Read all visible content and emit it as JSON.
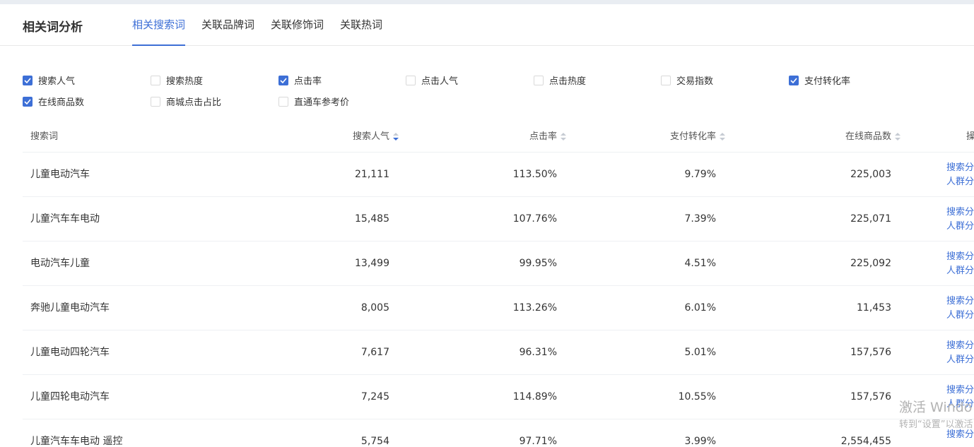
{
  "page": {
    "title": "相关词分析"
  },
  "tabs": [
    {
      "label": "相关搜索词",
      "active": true
    },
    {
      "label": "关联品牌词",
      "active": false
    },
    {
      "label": "关联修饰词",
      "active": false
    },
    {
      "label": "关联热词",
      "active": false
    }
  ],
  "metrics": [
    {
      "label": "搜索人气",
      "checked": true
    },
    {
      "label": "搜索热度",
      "checked": false
    },
    {
      "label": "点击率",
      "checked": true
    },
    {
      "label": "点击人气",
      "checked": false
    },
    {
      "label": "点击热度",
      "checked": false
    },
    {
      "label": "交易指数",
      "checked": false
    },
    {
      "label": "支付转化率",
      "checked": true
    },
    {
      "label": "在线商品数",
      "checked": true
    },
    {
      "label": "商城点击占比",
      "checked": false
    },
    {
      "label": "直通车参考价",
      "checked": false
    }
  ],
  "table": {
    "columns": {
      "word": "搜索词",
      "popularity": "搜索人气",
      "ctr": "点击率",
      "pay_rate": "支付转化率",
      "goods": "在线商品数",
      "ops": "操"
    },
    "sort": {
      "column": "popularity",
      "direction": "desc"
    },
    "rows": [
      {
        "word": "儿童电动汽车",
        "popularity": "21,111",
        "ctr": "113.50%",
        "pay_rate": "9.79%",
        "goods": "225,003",
        "op1": "搜索分",
        "op2": "人群分"
      },
      {
        "word": "儿童汽车车电动",
        "popularity": "15,485",
        "ctr": "107.76%",
        "pay_rate": "7.39%",
        "goods": "225,071",
        "op1": "搜索分",
        "op2": "人群分"
      },
      {
        "word": "电动汽车儿童",
        "popularity": "13,499",
        "ctr": "99.95%",
        "pay_rate": "4.51%",
        "goods": "225,092",
        "op1": "搜索分",
        "op2": "人群分"
      },
      {
        "word": "奔驰儿童电动汽车",
        "popularity": "8,005",
        "ctr": "113.26%",
        "pay_rate": "6.01%",
        "goods": "11,453",
        "op1": "搜索分",
        "op2": "人群分"
      },
      {
        "word": "儿童电动四轮汽车",
        "popularity": "7,617",
        "ctr": "96.31%",
        "pay_rate": "5.01%",
        "goods": "157,576",
        "op1": "搜索分",
        "op2": "人群分"
      },
      {
        "word": "儿童四轮电动汽车",
        "popularity": "7,245",
        "ctr": "114.89%",
        "pay_rate": "10.55%",
        "goods": "157,576",
        "op1": "搜索分",
        "op2": "人群分"
      },
      {
        "word": "儿童汽车车电动 遥控",
        "popularity": "5,754",
        "ctr": "97.71%",
        "pay_rate": "3.99%",
        "goods": "2,554,455",
        "op1": "搜索分",
        "op2": ""
      }
    ]
  },
  "watermark": {
    "line1": "激活 Windo",
    "line2": "转到“设置”以激活"
  },
  "colors": {
    "accent": "#3d6fd6",
    "text": "#333333",
    "border": "#eef0f3"
  }
}
